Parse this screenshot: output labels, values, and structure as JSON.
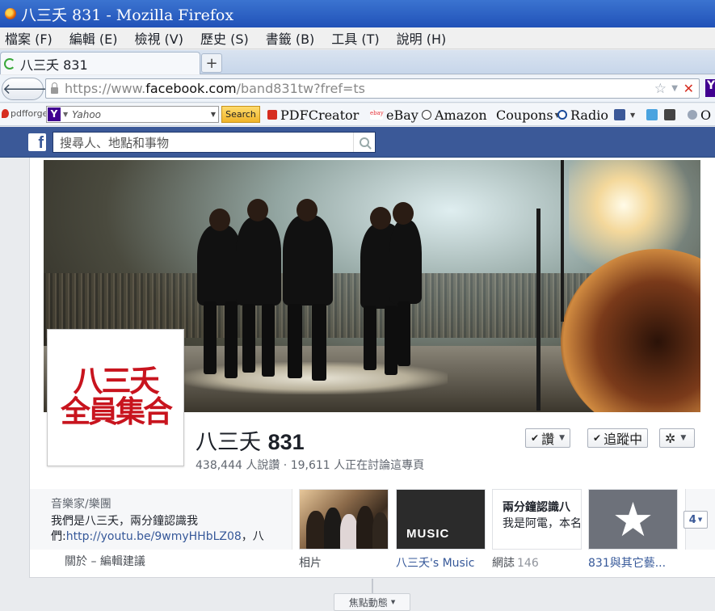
{
  "window": {
    "title": "八三夭 831 - Mozilla Firefox"
  },
  "menu": [
    "檔案 (F)",
    "編輯 (E)",
    "檢視 (V)",
    "歷史 (S)",
    "書籤 (B)",
    "工具 (T)",
    "說明 (H)"
  ],
  "tab": {
    "title": "八三夭 831",
    "new_tab_label": "+"
  },
  "nav": {
    "back": "🡐",
    "forward": "🡒",
    "url_prefix": "https://www.",
    "url_host": "facebook.com",
    "url_path": "/band831tw?fref=ts"
  },
  "bookmarks": {
    "pdfforge": "pdfforge",
    "search_placeholder": "Yahoo",
    "search_button": "Search",
    "items": [
      "PDFCreator",
      "eBay",
      "Amazon",
      "Coupons",
      "Radio",
      "O"
    ]
  },
  "facebook": {
    "search_placeholder": "搜尋人、地點和事物",
    "page_name_cjk": "八三夭",
    "page_name_num": "831",
    "likes": "438,444 人說讚",
    "separator": "·",
    "talking": "19,611 人正在討論這專頁",
    "like_button": "讚",
    "follow_button": "追蹤中",
    "settings_glyph": "✲",
    "profile_logo_line1": "八三夭",
    "profile_logo_line2": "全員集合",
    "about": {
      "category": "音樂家/樂團",
      "desc_1": "我們是八三夭，兩分鐘認識我們:",
      "link": "http://youtu.be/9wmyHHbLZ08",
      "desc_2": "，八",
      "links": "關於 – 編輯建議"
    },
    "apps": [
      {
        "label": "相片",
        "count": ""
      },
      {
        "label": "八三夭's Music",
        "count": "",
        "thumb_text": "MUSIC"
      },
      {
        "label": "網誌",
        "count": "146",
        "thumb_title": "兩分鐘認識八",
        "thumb_line2": "我是阿電，本名"
      },
      {
        "label": "831與其它藝...",
        "count": ""
      }
    ],
    "more_count": "4",
    "recent_button": "焦點動態"
  },
  "colors": {
    "facebook_blue": "#3b5998",
    "link": "#365899",
    "logo_red": "#c8141e",
    "firefox_title": "#2152b8"
  }
}
